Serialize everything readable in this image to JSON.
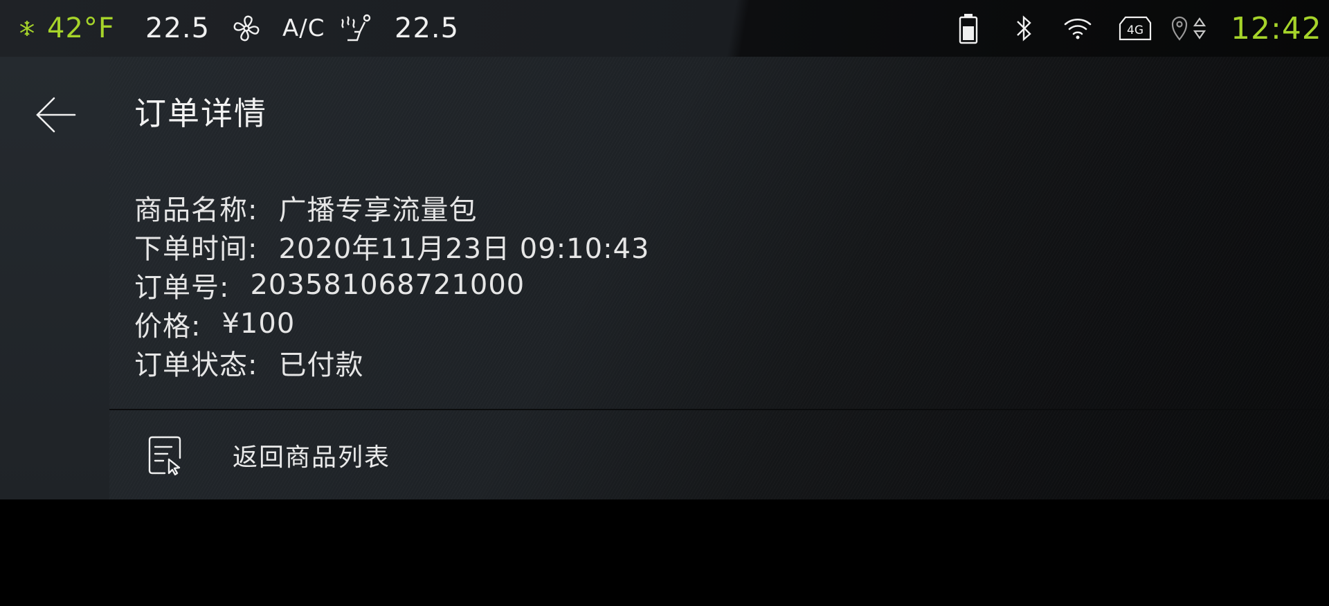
{
  "status_bar": {
    "outside_temp": "42°F",
    "driver_temp": "22.5",
    "ac_label": "A/C",
    "passenger_temp": "22.5",
    "clock": "12:42",
    "network_label": "4G",
    "accent_color": "#a6d42a",
    "icons": [
      "snowflake-icon",
      "fan-icon",
      "seat-heat-icon",
      "battery-icon",
      "bluetooth-icon",
      "wifi-icon",
      "4g-icon",
      "location-icon"
    ]
  },
  "page": {
    "title": "订单详情",
    "back_icon": "arrow-left-icon"
  },
  "order": {
    "product_label": "商品名称:",
    "product_value": "广播专享流量包",
    "time_label": "下单时间:",
    "time_value": "2020年11月23日 09:10:43",
    "number_label": "订单号:",
    "number_value": "203581068721000",
    "price_label": "价格:",
    "price_value": "¥100",
    "status_label": "订单状态:",
    "status_value": "已付款"
  },
  "action": {
    "label": "返回商品列表",
    "icon": "document-pointer-icon"
  }
}
